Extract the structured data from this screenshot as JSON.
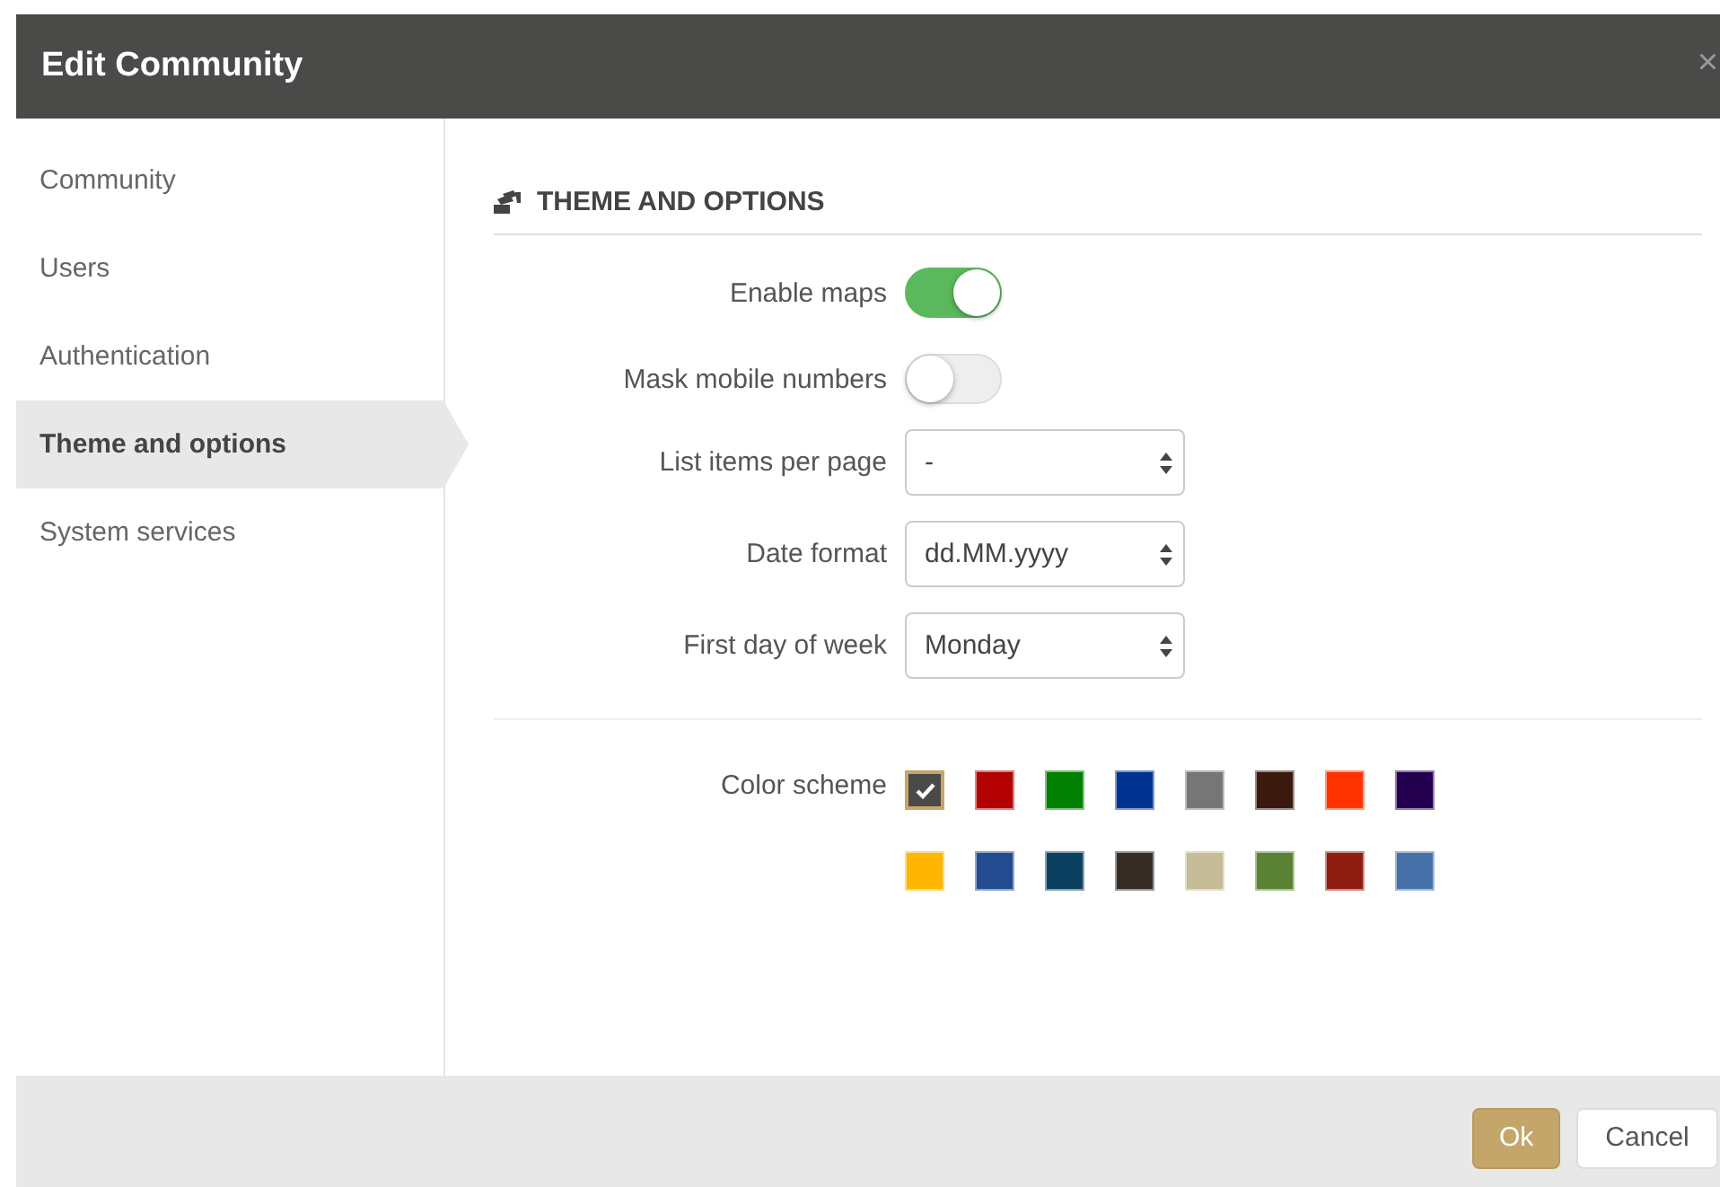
{
  "dialog": {
    "title": "Edit Community",
    "close": "×"
  },
  "sidebar": {
    "items": [
      {
        "label": "Community",
        "selected": false
      },
      {
        "label": "Users",
        "selected": false
      },
      {
        "label": "Authentication",
        "selected": false
      },
      {
        "label": "Theme and options",
        "selected": true
      },
      {
        "label": "System services",
        "selected": false
      }
    ]
  },
  "section": {
    "title": "THEME AND OPTIONS"
  },
  "fields": [
    {
      "kind": "toggle",
      "label": "Enable maps",
      "on": true
    },
    {
      "kind": "toggle",
      "label": "Mask mobile numbers",
      "on": false
    },
    {
      "kind": "select",
      "label": "List items per page",
      "value": "-"
    },
    {
      "kind": "select",
      "label": "Date format",
      "value": "dd.MM.yyyy"
    },
    {
      "kind": "select",
      "label": "First day of week",
      "value": "Monday"
    }
  ],
  "color_scheme": {
    "label": "Color scheme",
    "swatches": [
      {
        "color": "#4a4a4a",
        "selected": true
      },
      {
        "color": "#b30000",
        "selected": false
      },
      {
        "color": "#007f00",
        "selected": false
      },
      {
        "color": "#003390",
        "selected": false
      },
      {
        "color": "#767676",
        "selected": false
      },
      {
        "color": "#3b1a0d",
        "selected": false
      },
      {
        "color": "#ff3300",
        "selected": false
      },
      {
        "color": "#240050",
        "selected": false
      },
      {
        "color": "#ffb600",
        "selected": false
      },
      {
        "color": "#234b90",
        "selected": false
      },
      {
        "color": "#0c4060",
        "selected": false
      },
      {
        "color": "#352c25",
        "selected": false
      },
      {
        "color": "#c7bc98",
        "selected": false
      },
      {
        "color": "#5a8234",
        "selected": false
      },
      {
        "color": "#8f1c10",
        "selected": false
      },
      {
        "color": "#4671a8",
        "selected": false
      }
    ]
  },
  "buttons": [
    {
      "kind": "primary",
      "label": "Ok"
    },
    {
      "kind": "default",
      "label": "Cancel"
    }
  ]
}
